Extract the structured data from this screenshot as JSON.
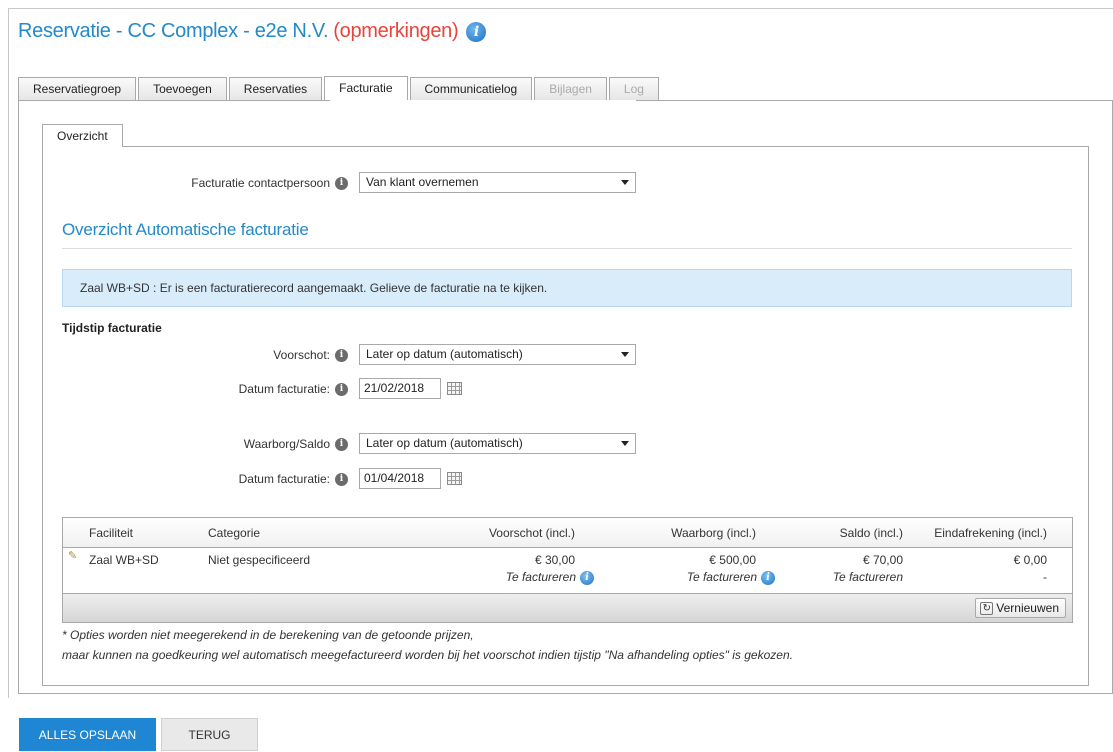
{
  "header": {
    "title": "Reservatie - CC Complex - e2e N.V.",
    "remarks": "(opmerkingen)",
    "info_icon": "info-icon"
  },
  "tabs": [
    {
      "label": "Reservatiegroep",
      "state": "normal"
    },
    {
      "label": "Toevoegen",
      "state": "normal"
    },
    {
      "label": "Reservaties",
      "state": "normal"
    },
    {
      "label": "Facturatie",
      "state": "active"
    },
    {
      "label": "Communicatielog",
      "state": "normal"
    },
    {
      "label": "Bijlagen",
      "state": "disabled"
    },
    {
      "label": "Log",
      "state": "disabled"
    }
  ],
  "subtabs": [
    {
      "label": "Overzicht"
    }
  ],
  "contact": {
    "label": "Facturatie contactpersoon",
    "value": "Van klant overnemen"
  },
  "section_title": "Overzicht Automatische facturatie",
  "alert_text": "Zaal WB+SD : Er is een facturatierecord aangemaakt. Gelieve de facturatie na te kijken.",
  "timing": {
    "title": "Tijdstip facturatie",
    "voorschot_label": "Voorschot:",
    "voorschot_value": "Later op datum (automatisch)",
    "datum1_label": "Datum facturatie:",
    "datum1_value": "21/02/2018",
    "waarborg_label": "Waarborg/Saldo",
    "waarborg_value": "Later op datum (automatisch)",
    "datum2_label": "Datum facturatie:",
    "datum2_value": "01/04/2018"
  },
  "table": {
    "headers": [
      "Faciliteit",
      "Categorie",
      "Voorschot (incl.)",
      "Waarborg (incl.)",
      "Saldo (incl.)",
      "Eindafrekening (incl.)"
    ],
    "rows": [
      {
        "faciliteit": "Zaal WB+SD",
        "categorie": "Niet gespecificeerd",
        "voorschot": "€ 30,00",
        "voorschot_status": "Te factureren",
        "waarborg": "€ 500,00",
        "waarborg_status": "Te factureren",
        "saldo": "€ 70,00",
        "saldo_status": "Te factureren",
        "eind": "€ 0,00",
        "eind_status": "-"
      }
    ],
    "refresh_label": "Vernieuwen"
  },
  "notes": [
    "* Opties worden niet meegerekend in de berekening van de getoonde prijzen,",
    "maar kunnen na goedkeuring wel automatisch meegefactureerd worden bij het voorschot indien tijstip \"Na afhandeling opties\" is gekozen."
  ],
  "footer": {
    "save_label": "ALLES OPSLAAN",
    "back_label": "TERUG"
  },
  "colors": {
    "accent": "#2389c9",
    "remarks": "#e8443b",
    "primary_button": "#1f86d4",
    "alert_bg": "#d8ecfa"
  }
}
